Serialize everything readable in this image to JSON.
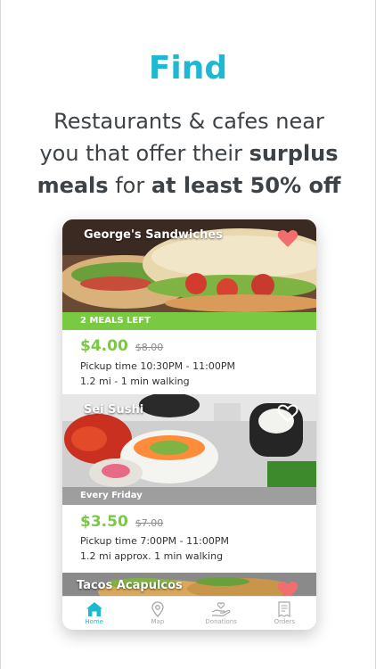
{
  "headline": "Find",
  "tagline": {
    "line1": "Restaurants & cafes near",
    "line2_pre": "you that offer their ",
    "line2_bold": "surplus",
    "line3_bold_a": "meals",
    "line3_mid": " for ",
    "line3_bold_b": "at least 50% off"
  },
  "cards": [
    {
      "name": "George's Sandwiches",
      "strip": "2 MEALS LEFT",
      "price": "$4.00",
      "old_price": "$8.00",
      "pickup": "Pickup time 10:30PM - 11:00PM",
      "distance": "1.2 mi - 1 min walking",
      "favorite": true
    },
    {
      "name": "Sei Sushi",
      "strip": "Every Friday",
      "price": "$3.50",
      "old_price": "$7.00",
      "pickup": "Pickup time 7:00PM - 11:00PM",
      "distance": "1.2 mi approx. 1 min walking",
      "favorite": false
    },
    {
      "name": "Tacos Acapulcos",
      "favorite": true
    }
  ],
  "tabs": [
    {
      "label": "Home",
      "icon": "home-icon",
      "active": true
    },
    {
      "label": "Map",
      "icon": "map-pin-icon",
      "active": false
    },
    {
      "label": "Donations",
      "icon": "donation-hand-icon",
      "active": false
    },
    {
      "label": "Orders",
      "icon": "orders-receipt-icon",
      "active": false
    }
  ],
  "colors": {
    "accent": "#1fb8d3",
    "price_green": "#7ac943",
    "heart": "#f26d6d",
    "strip_gray": "#9e9e9e"
  }
}
